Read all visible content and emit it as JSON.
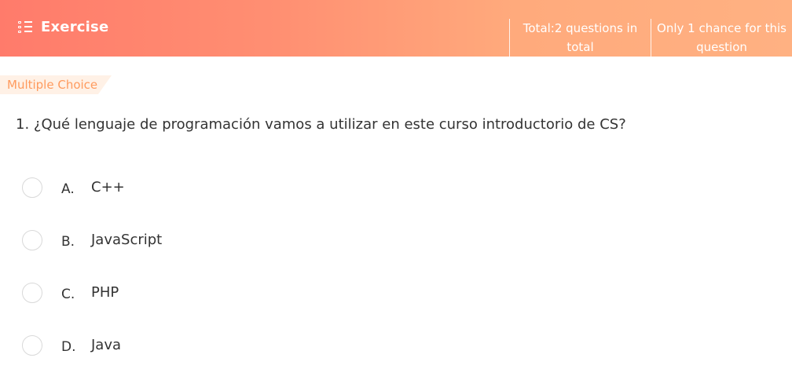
{
  "header": {
    "title": "Exercise",
    "total_line1": "Total:2 questions in",
    "total_line2": "total",
    "chance_line1": "Only 1 chance for this",
    "chance_line2": "question"
  },
  "question": {
    "type_label": "Multiple Choice",
    "text": "1. ¿Qué lenguaje de programación vamos a utilizar en este curso introductorio de CS?",
    "options": [
      {
        "letter": "A.",
        "text": "C++"
      },
      {
        "letter": "B.",
        "text": "JavaScript"
      },
      {
        "letter": "C.",
        "text": "PHP"
      },
      {
        "letter": "D.",
        "text": "Java"
      }
    ]
  },
  "colors": {
    "header_gradient_start": "#ff7b6b",
    "header_gradient_end": "#ffb182",
    "tag_text": "#ff9b5e",
    "tag_bg": "#fff1e6"
  },
  "icons": {
    "header_icon": "list-icon"
  }
}
